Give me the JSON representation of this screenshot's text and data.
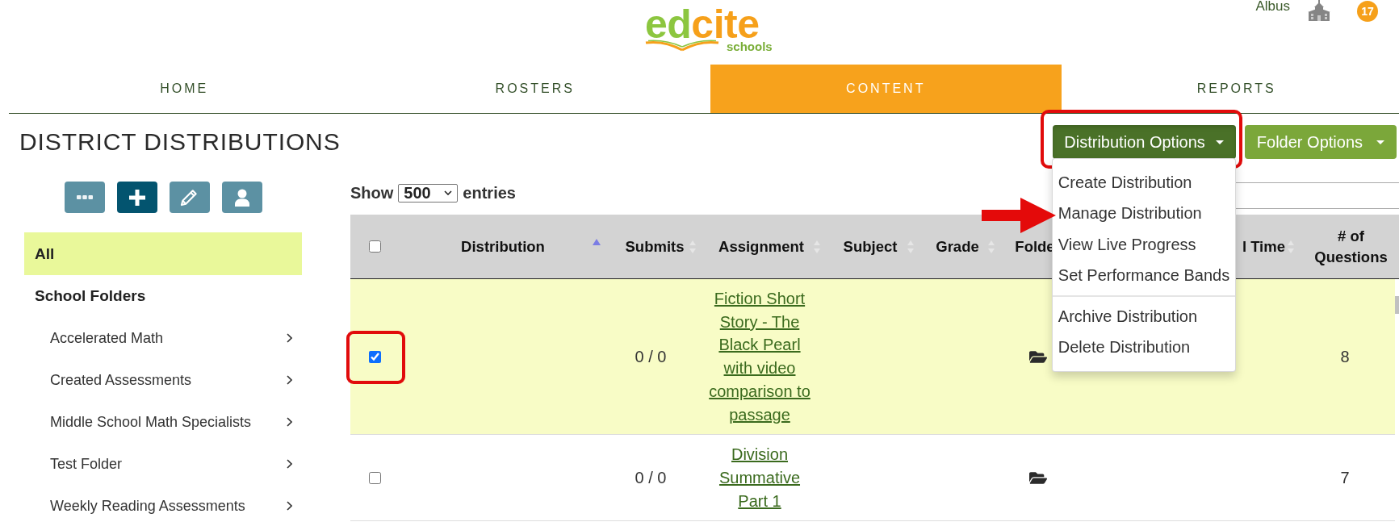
{
  "header": {
    "logo": {
      "wordmark": "edcite",
      "tagline": "schools"
    },
    "user_name": "Albus",
    "notification_count": "17"
  },
  "nav": {
    "tabs": [
      {
        "label": "HOME",
        "selected": false
      },
      {
        "label": "ROSTERS",
        "selected": false
      },
      {
        "label": "CONTENT",
        "selected": true
      },
      {
        "label": "REPORTS",
        "selected": false
      }
    ]
  },
  "page_title": "DISTRICT DISTRIBUTIONS",
  "actions": [
    {
      "label": "Distribution Options",
      "kind": "primary",
      "highlighted": true,
      "expanded": true,
      "menu": [
        {
          "items": [
            {
              "label": "Create Distribution",
              "annotated": false
            },
            {
              "label": "Manage Distribution",
              "annotated": true
            },
            {
              "label": "View Live Progress",
              "annotated": false
            },
            {
              "label": "Set Performance Bands",
              "annotated": false
            }
          ]
        },
        {
          "items": [
            {
              "label": "Archive Distribution",
              "annotated": false
            },
            {
              "label": "Delete Distribution",
              "annotated": false
            }
          ]
        }
      ]
    },
    {
      "label": "Folder Options",
      "kind": "secondary",
      "highlighted": false,
      "expanded": false
    }
  ],
  "sidebar": {
    "tool_buttons": [
      {
        "kind": "more",
        "active": false
      },
      {
        "kind": "add",
        "active": true
      },
      {
        "kind": "edit",
        "active": false
      },
      {
        "kind": "user",
        "active": false
      }
    ],
    "all": {
      "label": "All",
      "selected": true
    },
    "groups": [
      {
        "label": "School Folders",
        "children": [
          {
            "label": "Accelerated Math",
            "selected": false,
            "expanded": false
          },
          {
            "label": "Created Assessments",
            "selected": false,
            "expanded": false
          },
          {
            "label": "Middle School Math Specialists",
            "selected": false,
            "expanded": false
          },
          {
            "label": "Test Folder",
            "selected": false,
            "expanded": false
          },
          {
            "label": "Weekly Reading Assessments",
            "selected": false,
            "expanded": false
          }
        ]
      }
    ]
  },
  "entries": {
    "label": "Show",
    "value": "500",
    "suffix": "entries"
  },
  "table": {
    "columns": [
      {
        "kind": "checkbox",
        "checked": false
      },
      {
        "kind": "text",
        "label": "Distribution",
        "sortable": true,
        "sorted": true
      },
      {
        "kind": "text",
        "label": "Submits",
        "sortable": true,
        "sorted": false
      },
      {
        "kind": "text",
        "label": "Assignment",
        "sortable": true,
        "sorted": false
      },
      {
        "kind": "text",
        "label": "Subject",
        "sortable": true,
        "sorted": false
      },
      {
        "kind": "text",
        "label": "Grade",
        "sortable": true,
        "sorted": false
      },
      {
        "kind": "text",
        "label": "Folde"
      },
      {
        "kind": "text",
        "label": "l Time",
        "sortable": true,
        "sorted": false
      },
      {
        "kind": "text",
        "label": "# of Questions"
      }
    ],
    "rows": [
      {
        "selected": true,
        "highlighted": true,
        "submits": "0 / 0",
        "assignment": "Fiction Short Story - The Black Pearl with video comparison to passage",
        "questions": "8"
      },
      {
        "selected": false,
        "highlighted": false,
        "submits": "0 / 0",
        "assignment": "Division Summative Part 1",
        "questions": "7"
      }
    ]
  }
}
